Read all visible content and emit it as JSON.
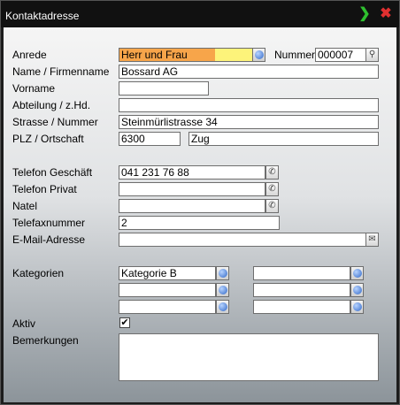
{
  "window": {
    "title": "Kontaktadresse"
  },
  "labels": {
    "anrede": "Anrede",
    "nummer": "Nummer",
    "name": "Name / Firmenname",
    "vorname": "Vorname",
    "abteilung": "Abteilung / z.Hd.",
    "strasse": "Strasse / Nummer",
    "plz": "PLZ / Ortschaft",
    "tel_geschaeft": "Telefon Geschäft",
    "tel_privat": "Telefon Privat",
    "natel": "Natel",
    "fax": "Telefaxnummer",
    "email": "E-Mail-Adresse",
    "kategorien": "Kategorien",
    "aktiv": "Aktiv",
    "bemerkungen": "Bemerkungen"
  },
  "values": {
    "anrede": "Herr und Frau",
    "nummer": "000007",
    "name": "Bossard AG",
    "vorname": "",
    "abteilung": "",
    "strasse": "Steinmürlistrasse 34",
    "plz": "6300",
    "ort": "Zug",
    "tel_geschaeft": "041 231 76 88",
    "tel_privat": "",
    "natel": "",
    "fax": "2",
    "email": "",
    "kategorie_1": "Kategorie B",
    "kategorie_2": "",
    "kategorie_3": "",
    "kategorie_4": "",
    "kategorie_5": "",
    "kategorie_6": "",
    "aktiv": true,
    "bemerkungen": ""
  },
  "icons": {
    "confirm": "arrow-right-icon",
    "close": "close-icon",
    "dropdown": "dropdown-icon",
    "phone": "phone-icon",
    "mail": "mail-icon",
    "search": "search-icon"
  },
  "colors": {
    "anrede_highlight_start": "#f7a54a",
    "anrede_highlight_end": "#fdf37a",
    "confirm": "#2fbf2f",
    "close": "#e03030"
  }
}
